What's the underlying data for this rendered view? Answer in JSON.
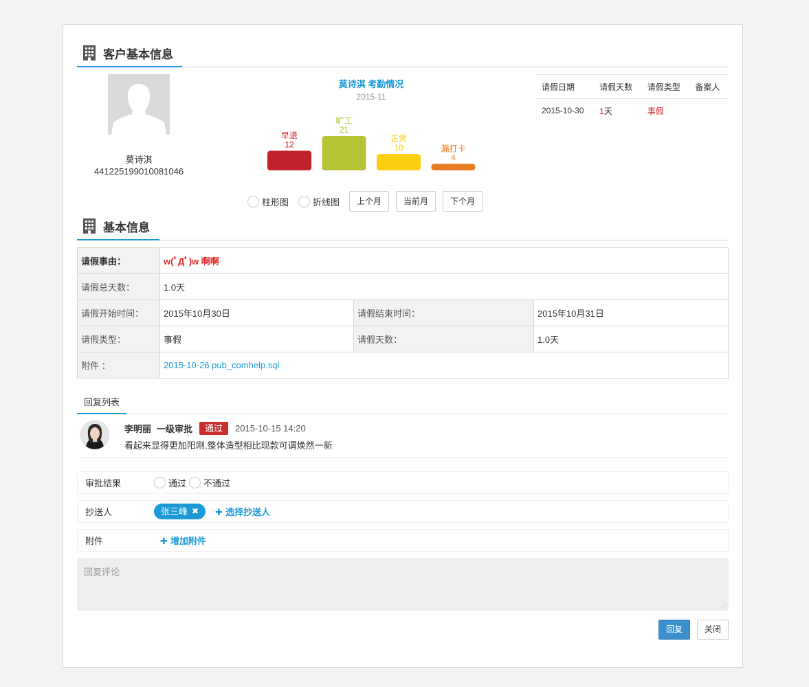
{
  "customer_section": {
    "title": "客户基本信息"
  },
  "customer": {
    "name": "莫诗淇",
    "id_number": "441225199010081046"
  },
  "chart_data": {
    "type": "bar",
    "title": "莫诗淇 考勤情况",
    "subtitle": "2015-11",
    "categories": [
      "早退",
      "旷工",
      "正常",
      "漏打卡"
    ],
    "values": [
      12,
      21,
      10,
      4
    ],
    "colors": [
      "#c1232b",
      "#b5c334",
      "#fcce10",
      "#e87c25"
    ]
  },
  "chart_controls": {
    "radio_bar": "柱形图",
    "radio_line": "折线图",
    "prev_month": "上个月",
    "current_month": "当前月",
    "next_month": "下个月"
  },
  "leave_table": {
    "headers": [
      "请假日期",
      "请假天数",
      "请假类型",
      "备案人"
    ],
    "rows": [
      {
        "date": "2015-10-30",
        "days_num": "1",
        "days_unit": "天",
        "type": "事假",
        "recorder": ""
      }
    ]
  },
  "basic_section": {
    "title": "基本信息"
  },
  "basic_info": {
    "reason_label": "请假事由：",
    "reason_value": "w(ﾟДﾟ)w 啊啊",
    "total_days_label": "请假总天数：",
    "total_days_value": "1.0天",
    "start_label": "请假开始时间：",
    "start_value": "2015年10月30日",
    "end_label": "请假结束时间：",
    "end_value": "2015年10月31日",
    "type_label": "请假类型：",
    "type_value": "事假",
    "days_label": "请假天数：",
    "days_value": "1.0天",
    "attachment_label": "附件 ：",
    "attachment_value": "2015-10-26 pub_comhelp.sql"
  },
  "reply_list": {
    "tab_label": "回复列表",
    "items": [
      {
        "name": "李明丽",
        "level": "一级审批",
        "status": "通过",
        "time": "2015-10-15 14:20",
        "text": "看起来显得更加阳刚,整体造型相比现款可谓焕然一新"
      }
    ]
  },
  "form": {
    "result_label": "审批结果",
    "approve_option": "通过",
    "reject_option": "不通过",
    "cc_label": "抄送人",
    "cc_person": "张三峰",
    "cc_remove": "✖",
    "cc_add": "选择抄送人",
    "attach_label": "附件",
    "attach_add": "增加附件",
    "comment_placeholder": "回复评论",
    "reply_button": "回复",
    "close_button": "关闭"
  }
}
